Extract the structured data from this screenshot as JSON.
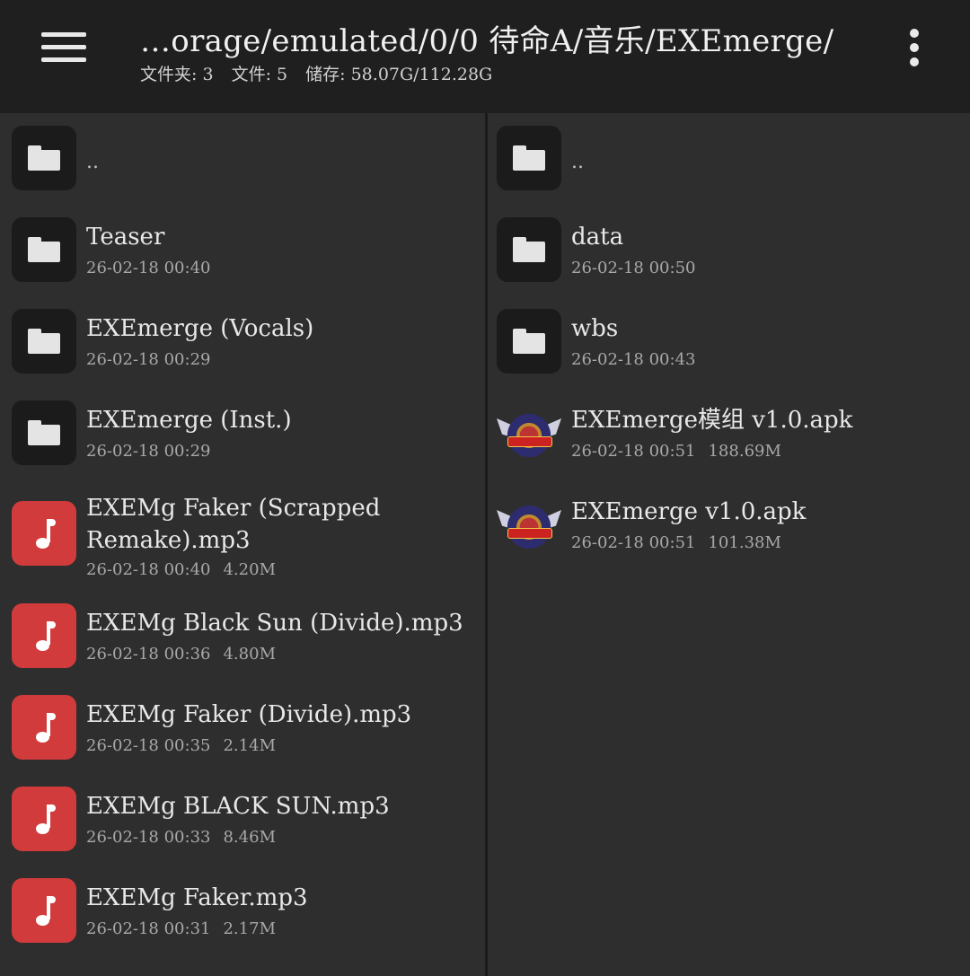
{
  "header": {
    "path": "…orage/emulated/0/0 待命A/音乐/EXEmerge/",
    "folders": "文件夹: 3",
    "files": "文件: 5",
    "storage": "储存: 58.07G/112.28G"
  },
  "left_pane": {
    "parent": "..",
    "items": [
      {
        "name": "Teaser",
        "date": "26-02-18 00:40",
        "size": "",
        "type": "folder"
      },
      {
        "name": "EXEmerge (Vocals)",
        "date": "26-02-18 00:29",
        "size": "",
        "type": "folder"
      },
      {
        "name": "EXEmerge (Inst.)",
        "date": "26-02-18 00:29",
        "size": "",
        "type": "folder"
      },
      {
        "name": "EXEMg Faker (Scrapped Remake).mp3",
        "date": "26-02-18 00:40",
        "size": "4.20M",
        "type": "music"
      },
      {
        "name": "EXEMg Black Sun (Divide).mp3",
        "date": "26-02-18 00:36",
        "size": "4.80M",
        "type": "music"
      },
      {
        "name": "EXEMg Faker (Divide).mp3",
        "date": "26-02-18 00:35",
        "size": "2.14M",
        "type": "music"
      },
      {
        "name": "EXEMg BLACK SUN.mp3",
        "date": "26-02-18 00:33",
        "size": "8.46M",
        "type": "music"
      },
      {
        "name": "EXEMg Faker.mp3",
        "date": "26-02-18 00:31",
        "size": "2.17M",
        "type": "music"
      }
    ]
  },
  "right_pane": {
    "parent": "..",
    "items": [
      {
        "name": "data",
        "date": "26-02-18 00:50",
        "size": "",
        "type": "folder"
      },
      {
        "name": "wbs",
        "date": "26-02-18 00:43",
        "size": "",
        "type": "folder"
      },
      {
        "name": "EXEmerge模组 v1.0.apk",
        "date": "26-02-18 00:51",
        "size": "188.69M",
        "type": "apk"
      },
      {
        "name": "EXEmerge v1.0.apk",
        "date": "26-02-18 00:51",
        "size": "101.38M",
        "type": "apk"
      }
    ]
  },
  "colors": {
    "topbar": "#1f1f1f",
    "background": "#2e2e2e",
    "music_icon": "#d23b3b",
    "folder_icon_bg": "#1b1b1b"
  },
  "icons": {
    "menu": "hamburger-menu-icon",
    "more": "more-vertical-icon",
    "folder": "folder-icon",
    "music": "music-note-icon",
    "apk": "apk-app-icon"
  }
}
